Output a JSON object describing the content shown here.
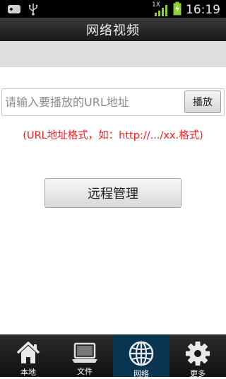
{
  "status_bar": {
    "time": "16:19",
    "network_type": "1X",
    "icons": [
      "usb-debug-icon",
      "usb-icon",
      "signal-icon",
      "battery-icon"
    ]
  },
  "header": {
    "title": "网络视频"
  },
  "url_input": {
    "placeholder": "请输入要播放的URL地址",
    "value": ""
  },
  "play_button": {
    "label": "播放"
  },
  "hint": {
    "text": "(URL地址格式，如：http://.../xx.格式)",
    "color": "#ff1a1a"
  },
  "remote_button": {
    "label": "远程管理"
  },
  "tabs": [
    {
      "label": "本地",
      "icon": "home-icon",
      "active": false
    },
    {
      "label": "文件",
      "icon": "laptop-icon",
      "active": false
    },
    {
      "label": "网络",
      "icon": "globe-icon",
      "active": true
    },
    {
      "label": "更多",
      "icon": "gear-icon",
      "active": false
    }
  ],
  "colors": {
    "active_tab": "#0a3550",
    "battery": "#8cd22c",
    "signal": "#8cd22c"
  }
}
